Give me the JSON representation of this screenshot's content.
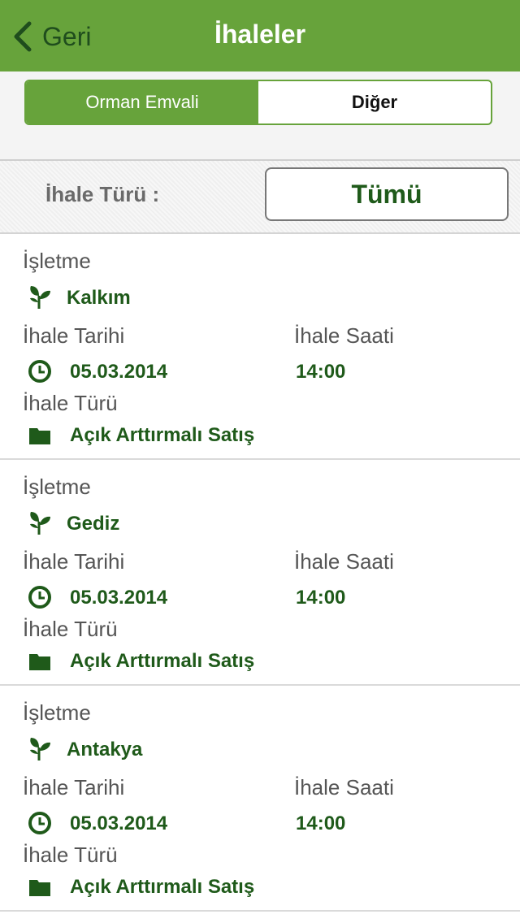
{
  "navbar": {
    "back_label": "Geri",
    "title": "İhaleler"
  },
  "segments": {
    "first": "Orman Emvali",
    "second": "Diğer"
  },
  "filter": {
    "label": "İhale Türü :",
    "value": "Tümü"
  },
  "items": [
    {
      "isletme_label": "İşletme",
      "isletme": "Kalkım",
      "tarih_label": "İhale Tarihi",
      "tarih": "05.03.2014",
      "saat_label": "İhale Saati",
      "saat": "14:00",
      "tur_label": "İhale Türü",
      "tur": "Açık Arttırmalı Satış"
    },
    {
      "isletme_label": "İşletme",
      "isletme": "Gediz",
      "tarih_label": "İhale Tarihi",
      "tarih": "05.03.2014",
      "saat_label": "İhale Saati",
      "saat": "14:00",
      "tur_label": "İhale Türü",
      "tur": "Açık Arttırmalı Satış"
    },
    {
      "isletme_label": "İşletme",
      "isletme": "Antakya",
      "tarih_label": "İhale Tarihi",
      "tarih": "05.03.2014",
      "saat_label": "İhale Saati",
      "saat": "14:00",
      "tur_label": "İhale Türü",
      "tur": "Açık Arttırmalı Satış"
    }
  ],
  "icons": {
    "back": "chevron-left-icon",
    "isletme": "leaf-icon",
    "tarih": "clock-icon",
    "tur": "folder-icon"
  },
  "colors": {
    "primary_green": "#67a33b",
    "dark_green": "#1f5a1a"
  }
}
